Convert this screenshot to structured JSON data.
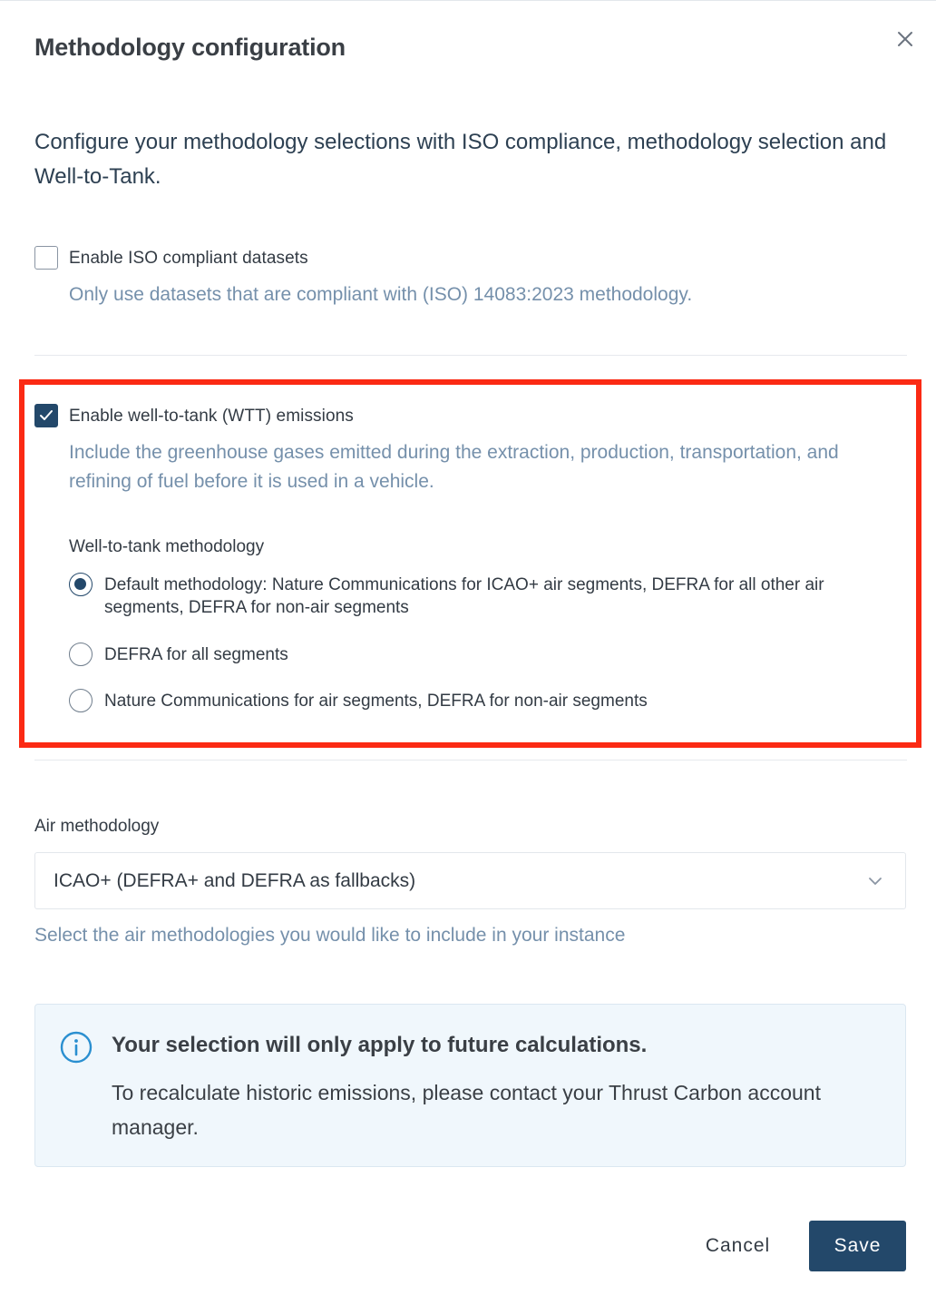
{
  "dialog": {
    "title": "Methodology configuration",
    "close_icon": "close-icon",
    "intro": "Configure your methodology selections with ISO compliance, methodology selection and Well-to-Tank."
  },
  "iso": {
    "checked": false,
    "label": "Enable ISO compliant datasets",
    "help": "Only use datasets that are compliant with (ISO) 14083:2023 methodology."
  },
  "wtt": {
    "checked": true,
    "label": "Enable well-to-tank (WTT) emissions",
    "help": "Include the greenhouse gases emitted during the extraction, production, transportation, and refining of fuel before it is used in a vehicle.",
    "group_label": "Well-to-tank methodology",
    "options": [
      {
        "label": "Default methodology: Nature Communications for ICAO+ air segments, DEFRA for all other air segments, DEFRA for non-air segments",
        "selected": true
      },
      {
        "label": "DEFRA for all segments",
        "selected": false
      },
      {
        "label": "Nature Communications for air segments, DEFRA for non-air segments",
        "selected": false
      }
    ]
  },
  "air": {
    "label": "Air methodology",
    "selected_value": "ICAO+ (DEFRA+ and DEFRA as fallbacks)",
    "help": "Select the air methodologies you would like to include in your instance"
  },
  "notice": {
    "icon": "info-icon",
    "title": "Your selection will only apply to future calculations.",
    "body": "To recalculate historic emissions, please contact your Thrust Carbon account manager."
  },
  "actions": {
    "cancel_label": "Cancel",
    "save_label": "Save"
  },
  "colors": {
    "primary": "#23486a",
    "help_text": "#7590ab",
    "highlight": "#fb2a14",
    "notice_bg": "#f0f7fc",
    "info_icon": "#2a8fd0"
  }
}
